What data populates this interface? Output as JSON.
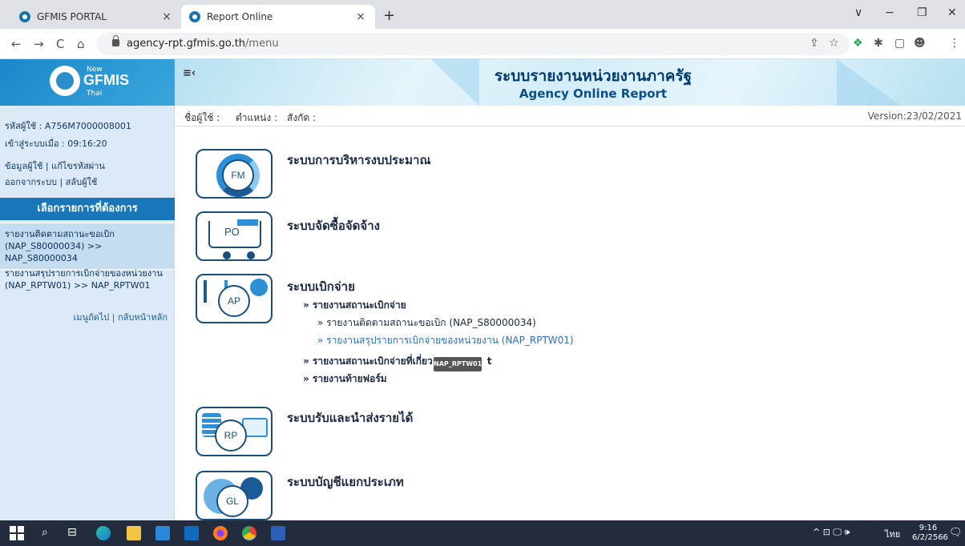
{
  "browser": {
    "tabs": [
      {
        "label": "GFMIS PORTAL",
        "close": "×"
      },
      {
        "label": "Report Online",
        "close": "×"
      }
    ],
    "new_tab": "+",
    "url_host": "agency-rpt.gfmis.go.th",
    "url_path": "/menu",
    "nav": {
      "back": "←",
      "forward": "→",
      "reload": "C",
      "home": "⌂"
    },
    "window": {
      "menu": "∨",
      "minimize": "−",
      "restore": "❐",
      "close": "✕"
    },
    "ext_icons": [
      "⇪",
      "☆",
      "❖",
      "✱",
      "▢",
      "☻",
      "⋮"
    ]
  },
  "header": {
    "logo_new": "New",
    "logo_text": "GFMIS",
    "logo_thai": "Thai",
    "toggle": "≡‹",
    "title": "ระบบรายงานหน่วยงานภาครัฐ",
    "subtitle": "Agency Online Report"
  },
  "infobar": {
    "user_label": "ชื่อผู้ใช้ :",
    "position_label": "ตำแหน่ง :",
    "affiliation_label": "สังกัด :",
    "version": "Version:23/02/2021"
  },
  "sidebar": {
    "user_id": "รหัสผู้ใช้ : A756M7000008001",
    "login_time": "เข้าสู่ระบบเมื่อ : 09:16:20",
    "user_info": "ข้อมูลผู้ใช้",
    "change_password": "แก้ไขรหัสผ่าน",
    "logout": "ออกจากระบบ",
    "switch_user": "สลับผู้ใช้",
    "sep": "|",
    "section_title": "เลือกรายการที่ต้องการ",
    "items": [
      {
        "line1": "รายงานติดตามสถานะขอเบิก",
        "line2": "(NAP_S80000034) >> NAP_S80000034"
      },
      {
        "line1": "รายงานสรุปรายการเบิกจ่ายของหน่วยงาน",
        "line2": "(NAP_RPTW01) >> NAP_RPTW01"
      }
    ],
    "footer_prev": "เมนูถัดไป",
    "footer_home": "กลับหน้าหลัก"
  },
  "modules": [
    {
      "icon": "FM",
      "title": "ระบบการบริหารงบประมาณ"
    },
    {
      "icon": "PO",
      "title": "ระบบจัดซื้อจัดจ้าง"
    },
    {
      "icon": "AP",
      "title": "ระบบเบิกจ่าย"
    },
    {
      "icon": "RP",
      "title": "ระบบรับและนำส่งรายได้"
    },
    {
      "icon": "GL",
      "title": "ระบบบัญชีแยกประเภท"
    }
  ],
  "ap_menu": {
    "l1_status": "» รายงานสถานะเบิกจ่าย",
    "l2_a": "» รายงานติดตามสถานะขอเบิก (NAP_S80000034)",
    "l2_b": "» รายงานสรุปรายการเบิกจ่ายของหน่วยงาน (NAP_RPTW01)",
    "l1_related": "» รายงานสถานะเบิกจ่ายที่เกี่ยว",
    "l1_related_tail": "t",
    "l1_footer": "» รายงานท้ายฟอร์ม",
    "tooltip": "NAP_RPTW01"
  },
  "taskbar": {
    "time": "9:16",
    "date": "6/2/2566",
    "lang": "ไทย",
    "tray": "^ ⊡ 🖵 🕪",
    "notif": "🗨",
    "search": "⌕",
    "taskview": "⊟"
  }
}
